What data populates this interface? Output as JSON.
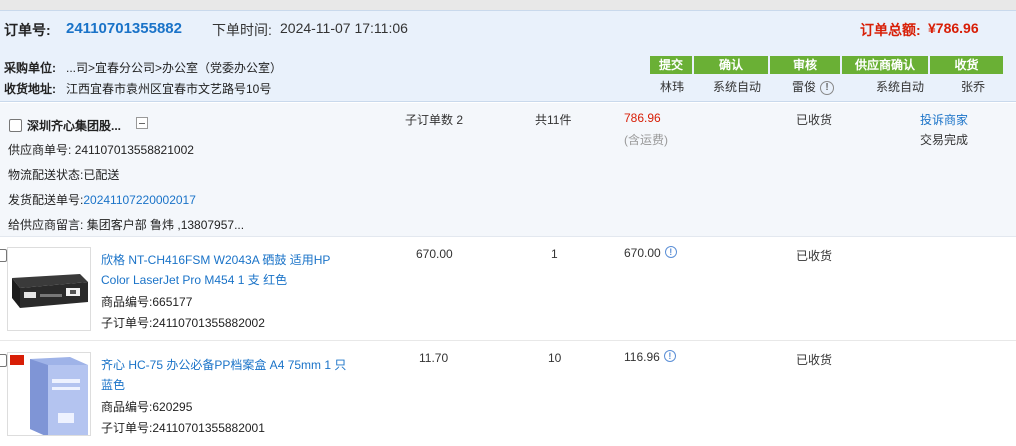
{
  "header": {
    "order_no_label": "订单号:",
    "order_no": "24110701355882",
    "order_time_label": "下单时间:",
    "order_time": "2024-11-07 17:11:06",
    "total_label": "订单总额:",
    "total": "¥786.96",
    "buyer_label": "采购单位:",
    "buyer": "...司>宜春分公司>办公室（党委办公室）",
    "address_label": "收货地址:",
    "address": "江西宜春市袁州区宜春市文艺路号10号"
  },
  "steps": [
    {
      "label": "提交",
      "person": "林玮"
    },
    {
      "label": "确认",
      "person": "系统自动"
    },
    {
      "label": "审核",
      "person": "雷俊"
    },
    {
      "label": "供应商确认",
      "person": "系统自动"
    },
    {
      "label": "收货",
      "person": "张乔"
    }
  ],
  "supplier": {
    "name": "深圳齐心集团股...",
    "supplier_order_label": "供应商单号:",
    "supplier_order": "241107013558821002",
    "logistics_label": "物流配送状态:",
    "logistics": "已配送",
    "shipment_label": "发货配送单号:",
    "shipment": "20241107220002017",
    "message_label": "给供应商留言:",
    "message": "集团客户部 鲁炜 ,13807957...",
    "sub_orders": "子订单数 2",
    "item_count": "共11件",
    "amount": "786.96",
    "freight_note": "(含运费)",
    "status": "已收货",
    "complain": "投诉商家",
    "trade_status": "交易完成"
  },
  "items": [
    {
      "title": "欣格 NT-CH416FSM W2043A 硒鼓 适用HP Color LaserJet Pro M454 1 支 红色",
      "product_code_label": "商品编号:",
      "product_code": "665177",
      "sub_order_label": "子订单号:",
      "sub_order": "24110701355882002",
      "price": "670.00",
      "qty": "1",
      "sum": "670.00",
      "status": "已收货"
    },
    {
      "title": "齐心 HC-75 办公必备PP档案盒 A4 75mm 1 只 蓝色",
      "product_code_label": "商品编号:",
      "product_code": "620295",
      "sub_order_label": "子订单号:",
      "sub_order": "24110701355882001",
      "price": "11.70",
      "qty": "10",
      "sum": "116.96",
      "status": "已收货"
    }
  ]
}
